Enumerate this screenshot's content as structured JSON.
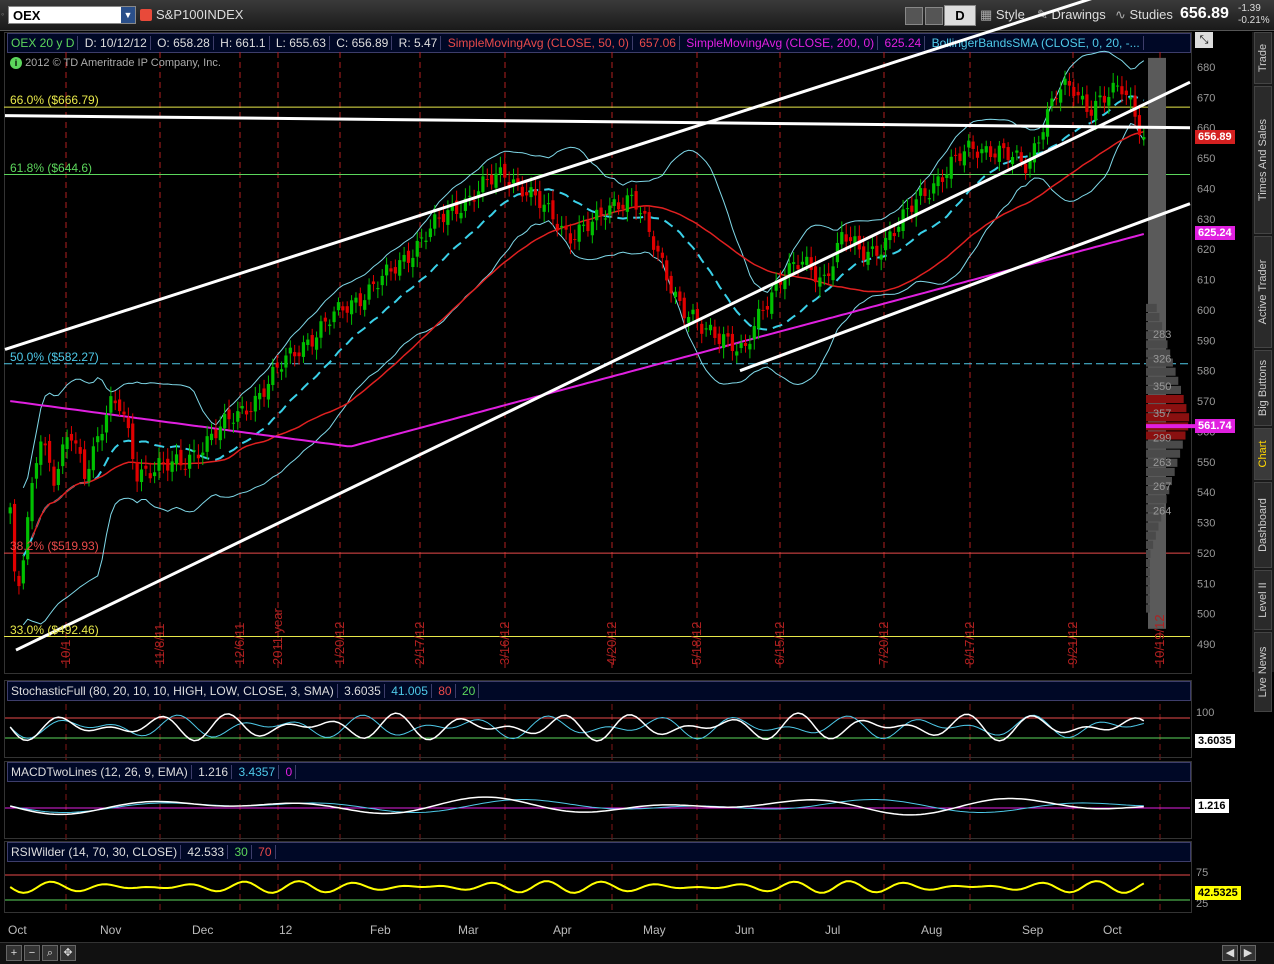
{
  "toolbar": {
    "symbol": "OEX",
    "description": "S&P100INDEX",
    "period_button": "D",
    "style_label": "Style",
    "drawings_label": "Drawings",
    "studies_label": "Studies",
    "last_price": "656.89",
    "change": "-1.39",
    "change_pct": "-0.21%"
  },
  "header": {
    "symbol_period": "OEX 20 y D",
    "date": "D: 10/12/12",
    "open": "O: 658.28",
    "high": "H: 661.1",
    "low": "L: 655.63",
    "close": "C: 656.89",
    "range": "R: 5.47",
    "sma50_label": "SimpleMovingAvg (CLOSE, 50, 0)",
    "sma50_value": "657.06",
    "sma200_label": "SimpleMovingAvg (CLOSE, 200, 0)",
    "sma200_value": "625.24",
    "bb_label": "BollingerBandsSMA (CLOSE, 0, 20, -..."
  },
  "copyright": "2012 © TD Ameritrade IP Company, Inc.",
  "fib_labels": [
    {
      "text": "66.0%  ($666.79)",
      "price": 666.79,
      "color": "#e8e84a"
    },
    {
      "text": "61.8%  ($644.6)",
      "price": 644.6,
      "color": "#5cd65c"
    },
    {
      "text": "50.0%  ($582.27)",
      "price": 582.27,
      "color": "#4ec9e8"
    },
    {
      "text": "38.2%  ($519.93)",
      "price": 519.93,
      "color": "#e84a4a"
    },
    {
      "text": "33.0%  ($492.46)",
      "price": 492.46,
      "color": "#e8e84a"
    }
  ],
  "price_badges": {
    "last": "656.89",
    "sma200": "625.24",
    "vp": "561.74"
  },
  "volume_profile_labels": [
    "283",
    "326",
    "350",
    "357",
    "299",
    "263",
    "267",
    "264"
  ],
  "vertical_date_labels": [
    "10/1",
    "11/8/11",
    "12/6/11",
    "2011 year",
    "1/20/12",
    "2/17/12",
    "3/16/12",
    "4/20/12",
    "5/18/12",
    "6/15/12",
    "7/20/12",
    "8/17/12",
    "9/21/12",
    "10/19/12"
  ],
  "month_labels": [
    "Oct",
    "Nov",
    "Dec",
    "12",
    "Feb",
    "Mar",
    "Apr",
    "May",
    "Jun",
    "Jul",
    "Aug",
    "Sep",
    "Oct"
  ],
  "stochastic": {
    "label": "StochasticFull (80, 20, 10, 10, HIGH, LOW, CLOSE, 3, SMA)",
    "value": "3.6035",
    "slowd": "41.005",
    "ob": "80",
    "os": "20",
    "axis_tick": "100",
    "badge": "3.6035"
  },
  "macd": {
    "label": "MACDTwoLines (12, 26, 9, EMA)",
    "value": "1.216",
    "avg": "3.4357",
    "zero": "0",
    "badge": "1.216"
  },
  "rsi": {
    "label": "RSIWilder (14, 70, 30, CLOSE)",
    "value": "42.533",
    "ob": "30",
    "os": "70",
    "axis_top": "75",
    "axis_bottom": "25",
    "badge": "42.5325"
  },
  "side_tabs": [
    "Trade",
    "Times And Sales",
    "Active Trader",
    "Big Buttons",
    "Chart",
    "Dashboard",
    "Level II",
    "Live News"
  ],
  "colors": {
    "up": "#00c000",
    "down": "#e00000",
    "sma50": "#e02020",
    "sma200": "#e020e0",
    "bb_mid": "#3ad0e8",
    "bb_band": "#7fd8e8",
    "trendline": "#ffffff"
  },
  "chart_data": {
    "type": "candlestick",
    "title": "OEX 20 y D",
    "ylim": [
      485,
      685
    ],
    "y_ticks": [
      490,
      500,
      510,
      520,
      530,
      540,
      550,
      560,
      570,
      580,
      590,
      600,
      610,
      620,
      630,
      640,
      650,
      660,
      670,
      680
    ],
    "monthly_closes_approx": [
      {
        "month": "Oct 2011",
        "close": 555
      },
      {
        "month": "Nov 2011",
        "close": 540
      },
      {
        "month": "Dec 2011",
        "close": 555
      },
      {
        "month": "Jan 2012",
        "close": 588
      },
      {
        "month": "Feb 2012",
        "close": 612
      },
      {
        "month": "Mar 2012",
        "close": 640
      },
      {
        "month": "Apr 2012",
        "close": 630
      },
      {
        "month": "May 2012",
        "close": 592
      },
      {
        "month": "Jun 2012",
        "close": 612
      },
      {
        "month": "Jul 2012",
        "close": 620
      },
      {
        "month": "Aug 2012",
        "close": 650
      },
      {
        "month": "Sep 2012",
        "close": 667
      },
      {
        "month": "Oct 2012",
        "close": 656.89
      }
    ],
    "sma50_last": 657.06,
    "sma200_last": 625.24
  }
}
